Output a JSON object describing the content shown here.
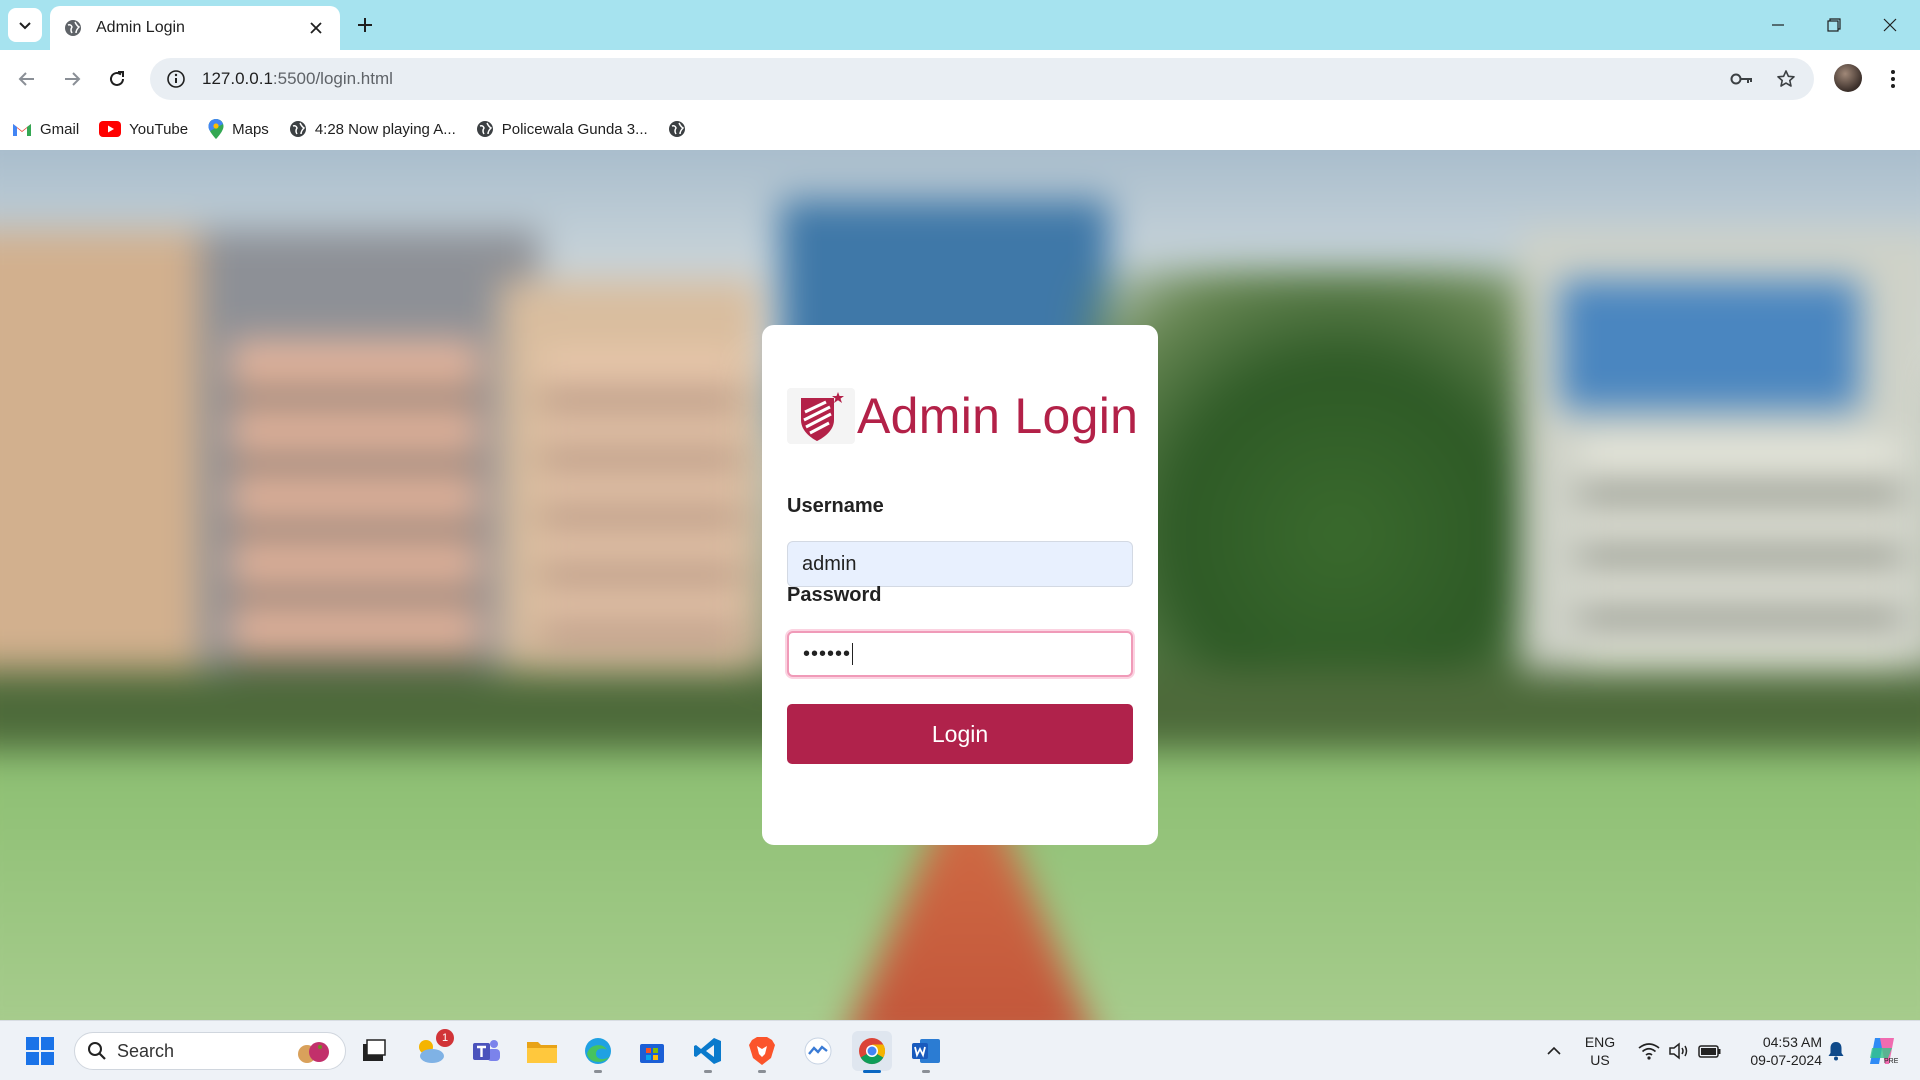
{
  "browser": {
    "tab_title": "Admin Login",
    "url_host": "127.0.0.1",
    "url_path": ":5500/login.html",
    "bookmarks": [
      {
        "label": "Gmail",
        "icon": "gmail-icon"
      },
      {
        "label": "YouTube",
        "icon": "youtube-icon"
      },
      {
        "label": "Maps",
        "icon": "maps-icon"
      },
      {
        "label": "4:28 Now playing A...",
        "icon": "globe-icon"
      },
      {
        "label": "Policewala Gunda 3...",
        "icon": "globe-icon"
      },
      {
        "label": "",
        "icon": "globe-icon"
      }
    ]
  },
  "login": {
    "title": "Admin Login",
    "username_label": "Username",
    "username_value": "admin",
    "password_label": "Password",
    "password_value": "••••••",
    "button_label": "Login",
    "accent_color": "#b0224b"
  },
  "taskbar": {
    "search_placeholder": "Search",
    "weather_badge": "1",
    "lang_line1": "ENG",
    "lang_line2": "US",
    "time": "04:53 AM",
    "date": "09-07-2024"
  }
}
